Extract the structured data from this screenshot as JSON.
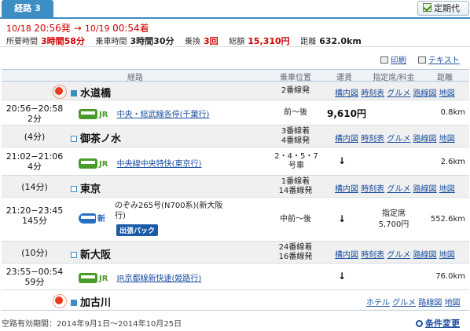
{
  "tab": {
    "label": "経路 3"
  },
  "teiki_button": {
    "label": "定期代"
  },
  "summary": {
    "depart_date": "10/18",
    "depart_time": "20:56発",
    "arrow": "→",
    "arrive_date": "10/19",
    "arrive_time": "00:54着",
    "total_time_label": "所要時間",
    "total_time": "3時間58分",
    "ride_time_label": "乗車時間",
    "ride_time": "3時間30分",
    "transfer_label": "乗換",
    "transfer": "3回",
    "fare_label": "総額",
    "fare": "15,310円",
    "distance_label": "距離",
    "distance": "632.0km"
  },
  "print_links": {
    "print": "印刷",
    "text": "テキスト"
  },
  "table_header": {
    "route": "経路",
    "position": "乗車位置",
    "fare": "運賃",
    "reserved": "指定席/料金",
    "distance": "距離"
  },
  "link_labels": {
    "station_map": "構内図",
    "timetable": "時刻表",
    "gourmet": "グルメ",
    "route_map": "路線図",
    "map": "地図",
    "hotel": "ホテル"
  },
  "stations": [
    {
      "name": "水道橋",
      "platform": "2番線発"
    },
    {
      "wait": "(4分)",
      "name": "御茶ノ水",
      "platform_1": "3番線着",
      "platform_2": "4番線発"
    },
    {
      "wait": "(14分)",
      "name": "東京",
      "platform_1": "1番線着",
      "platform_2": "14番線発"
    },
    {
      "wait": "(10分)",
      "name": "新大阪",
      "platform_1": "24番線着",
      "platform_2": "16番線発"
    },
    {
      "name": "加古川"
    }
  ],
  "segments": [
    {
      "time": "20:56−20:58",
      "duration": "2分",
      "carrier": "JR",
      "line": "中央・総武線各停(千葉行)",
      "position": "前〜後",
      "fare": "9,610円",
      "distance": "0.8km"
    },
    {
      "time": "21:02−21:06",
      "duration": "4分",
      "carrier": "JR",
      "line": "中央線中央特快(東京行)",
      "position": "2・4・5・7号車",
      "fare": "↓",
      "distance": "2.6km"
    },
    {
      "time": "21:20−23:45",
      "duration": "145分",
      "carrier": "新",
      "line": "のぞみ265号(N700系)(新大阪行)",
      "badge": "出張パック",
      "position": "中前〜後",
      "fare": "↓",
      "reserved_label": "指定席",
      "reserved_fare": "5,700円",
      "distance": "552.6km"
    },
    {
      "time": "23:55−00:54",
      "duration": "59分",
      "carrier": "JR",
      "line": "JR京都線新快速(姫路行)",
      "position": "",
      "fare": "↓",
      "distance": "76.0km"
    }
  ],
  "footer": {
    "validity": "空路有効期間：2014年9月1日〜2014年10月25日",
    "change_conditions": "条件変更"
  },
  "colors": {
    "accent": "#3d8ec4",
    "red": "#d00000",
    "link": "#1a4fa0",
    "jr_green": "#4a9a2a"
  }
}
